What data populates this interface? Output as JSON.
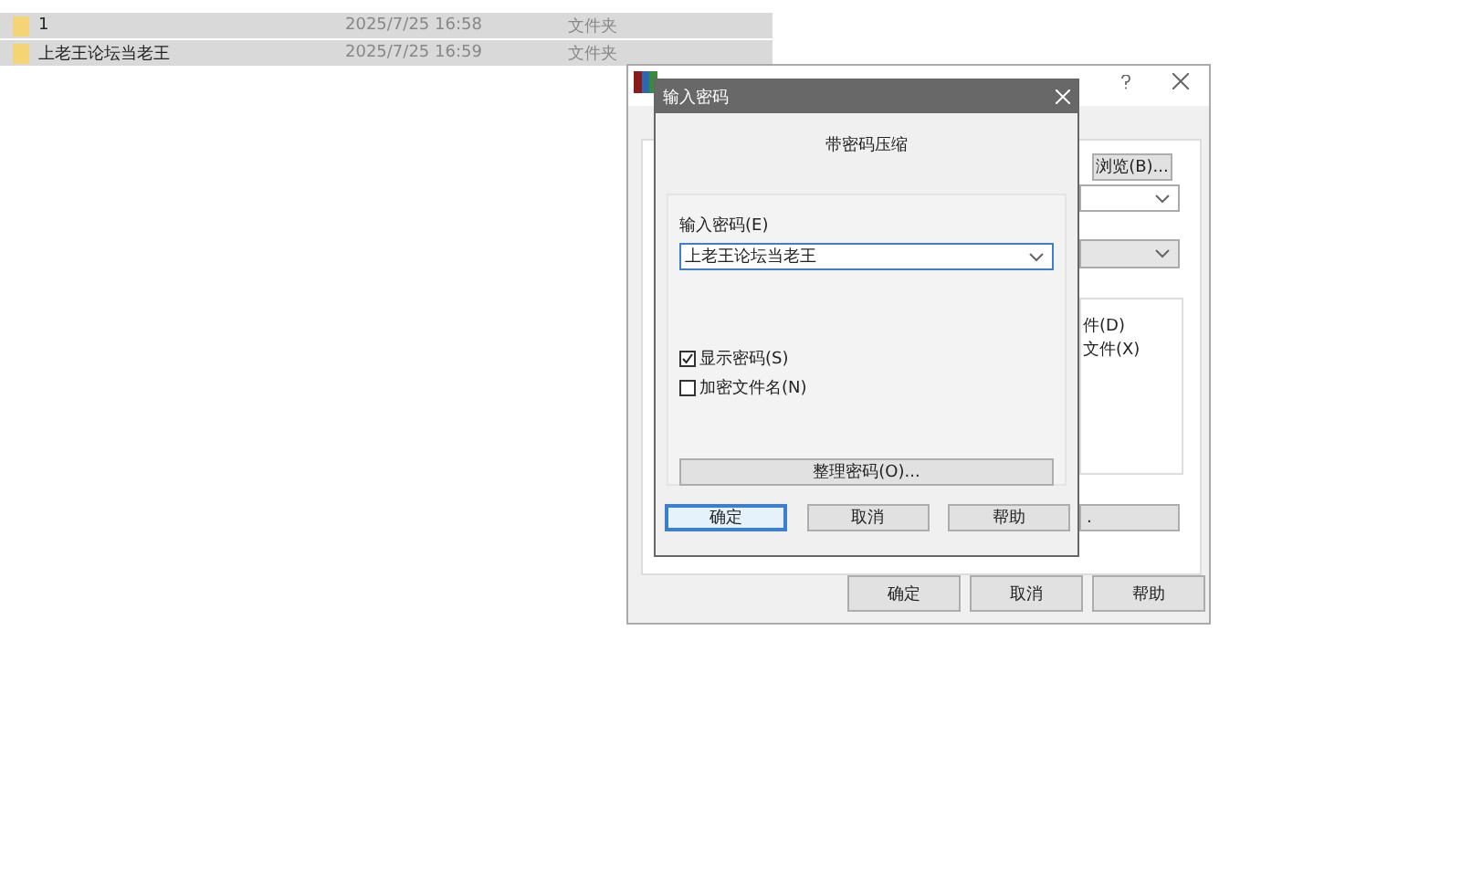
{
  "file_list": {
    "rows": [
      {
        "name": "1",
        "date": "2025/7/25 16:58",
        "type": "文件夹"
      },
      {
        "name": "上老王论坛当老王",
        "date": "2025/7/25 16:59",
        "type": "文件夹"
      }
    ]
  },
  "archive_window": {
    "browse_button": "浏览(B)...",
    "options": [
      "件(D)",
      "文件(X)"
    ],
    "partial_button": ".",
    "buttons": [
      "确定",
      "取消",
      "帮助"
    ]
  },
  "password_dialog": {
    "title": "输入密码",
    "heading": "带密码压缩",
    "password_label": "输入密码(E)",
    "password_value": "上老王论坛当老王",
    "checkboxes": [
      {
        "label": "显示密码(S)",
        "checked": true
      },
      {
        "label": "加密文件名(N)",
        "checked": false
      }
    ],
    "organize_button": "整理密码(O)...",
    "buttons": [
      {
        "label": "确定",
        "selected": true
      },
      {
        "label": "取消",
        "selected": false
      },
      {
        "label": "帮助",
        "selected": false
      }
    ]
  }
}
